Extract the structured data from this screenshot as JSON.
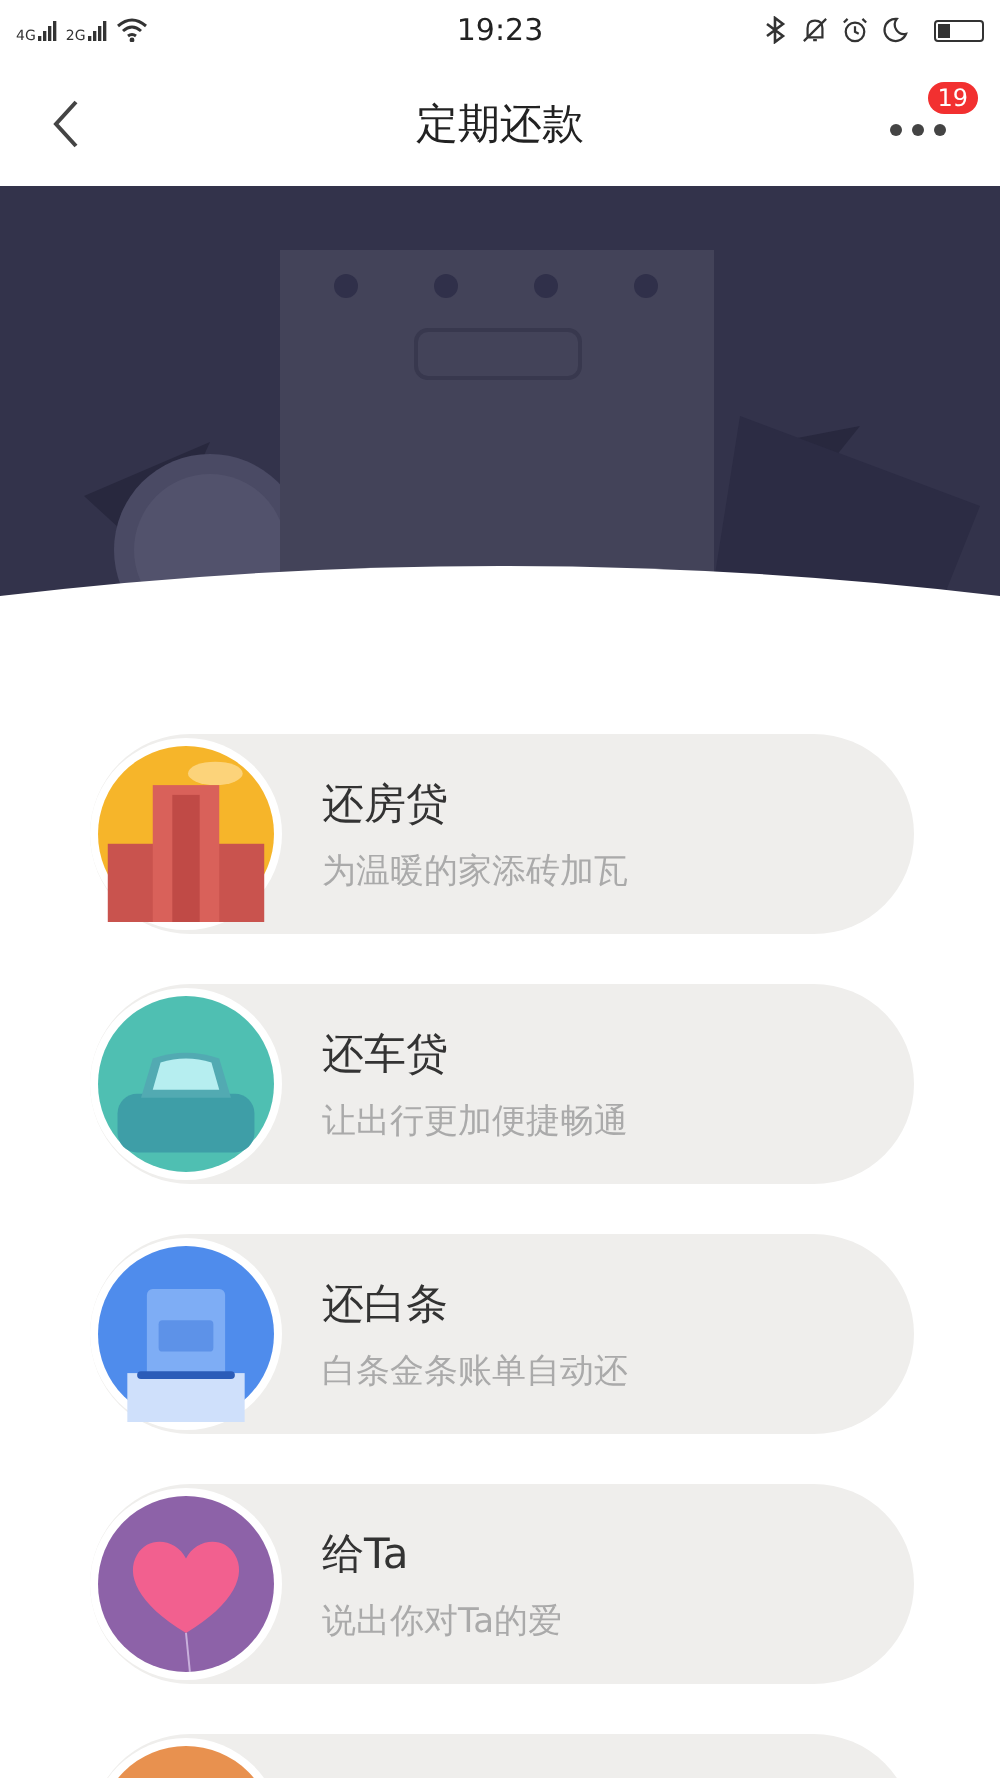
{
  "status_bar": {
    "network_1": "4G",
    "network_2": "2G",
    "time": "19:23",
    "battery": {
      "level": 0.3
    }
  },
  "header": {
    "title": "定期还款",
    "badge": "19"
  },
  "items": [
    {
      "kind": "house",
      "title": "还房贷",
      "subtitle": "为温暖的家添砖加瓦"
    },
    {
      "kind": "car",
      "title": "还车贷",
      "subtitle": "让出行更加便捷畅通"
    },
    {
      "kind": "bill",
      "title": "还白条",
      "subtitle": "白条金条账单自动还"
    },
    {
      "kind": "heart",
      "title": "给Ta",
      "subtitle": "说出你对Ta的爱"
    },
    {
      "kind": "partial"
    }
  ]
}
